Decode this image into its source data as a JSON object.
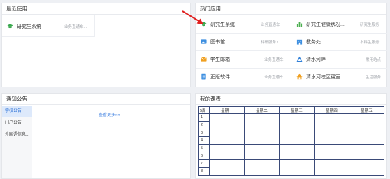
{
  "recent": {
    "title": "最近使用",
    "items": [
      {
        "name": "研究生系统",
        "desc": "业务直通车...",
        "icon": "graduation-cap-icon",
        "color": "#3aa84e"
      }
    ]
  },
  "popular": {
    "title": "热门应用",
    "items": [
      {
        "name": "研究生系统",
        "desc": "业务直通车",
        "icon": "graduation-cap-icon",
        "color": "#3aa84e"
      },
      {
        "name": "研究生健康状况...",
        "desc": "研究生服务",
        "icon": "bar-chart-icon",
        "color": "#4caf50"
      },
      {
        "name": "图书馆",
        "desc": "科研服务 / ...",
        "icon": "image-icon",
        "color": "#3d8fe0"
      },
      {
        "name": "教务处",
        "desc": "本科生服务...",
        "icon": "building-icon",
        "color": "#3d8fe0"
      },
      {
        "name": "学生邮箱",
        "desc": "业务直通车",
        "icon": "mail-icon",
        "color": "#f0a020"
      },
      {
        "name": "清水河畔",
        "desc": "常用站点",
        "icon": "triangle-flag-icon",
        "color": "#2f7fd8"
      },
      {
        "name": "正版软件",
        "desc": "业务直通车",
        "icon": "document-icon",
        "color": "#3d8fe0"
      },
      {
        "name": "清水河校区寝室...",
        "desc": "生活服务",
        "icon": "home-icon",
        "color": "#f0a020"
      }
    ]
  },
  "notice": {
    "title": "通知公告",
    "tabs": [
      "学校公告",
      "门户公告",
      "外国语信息..."
    ],
    "more": "查看更多»»"
  },
  "schedule": {
    "title": "我的课表",
    "corner": "5周",
    "days": [
      "星期一",
      "星期二",
      "星期三",
      "星期四",
      "星期五"
    ],
    "rows": [
      "1",
      "2",
      "3",
      "4",
      "5",
      "6",
      "7",
      "8"
    ]
  },
  "colors": {
    "accent": "#2a6fd6",
    "arrow": "#e02020",
    "table_border": "#3a4a78"
  }
}
